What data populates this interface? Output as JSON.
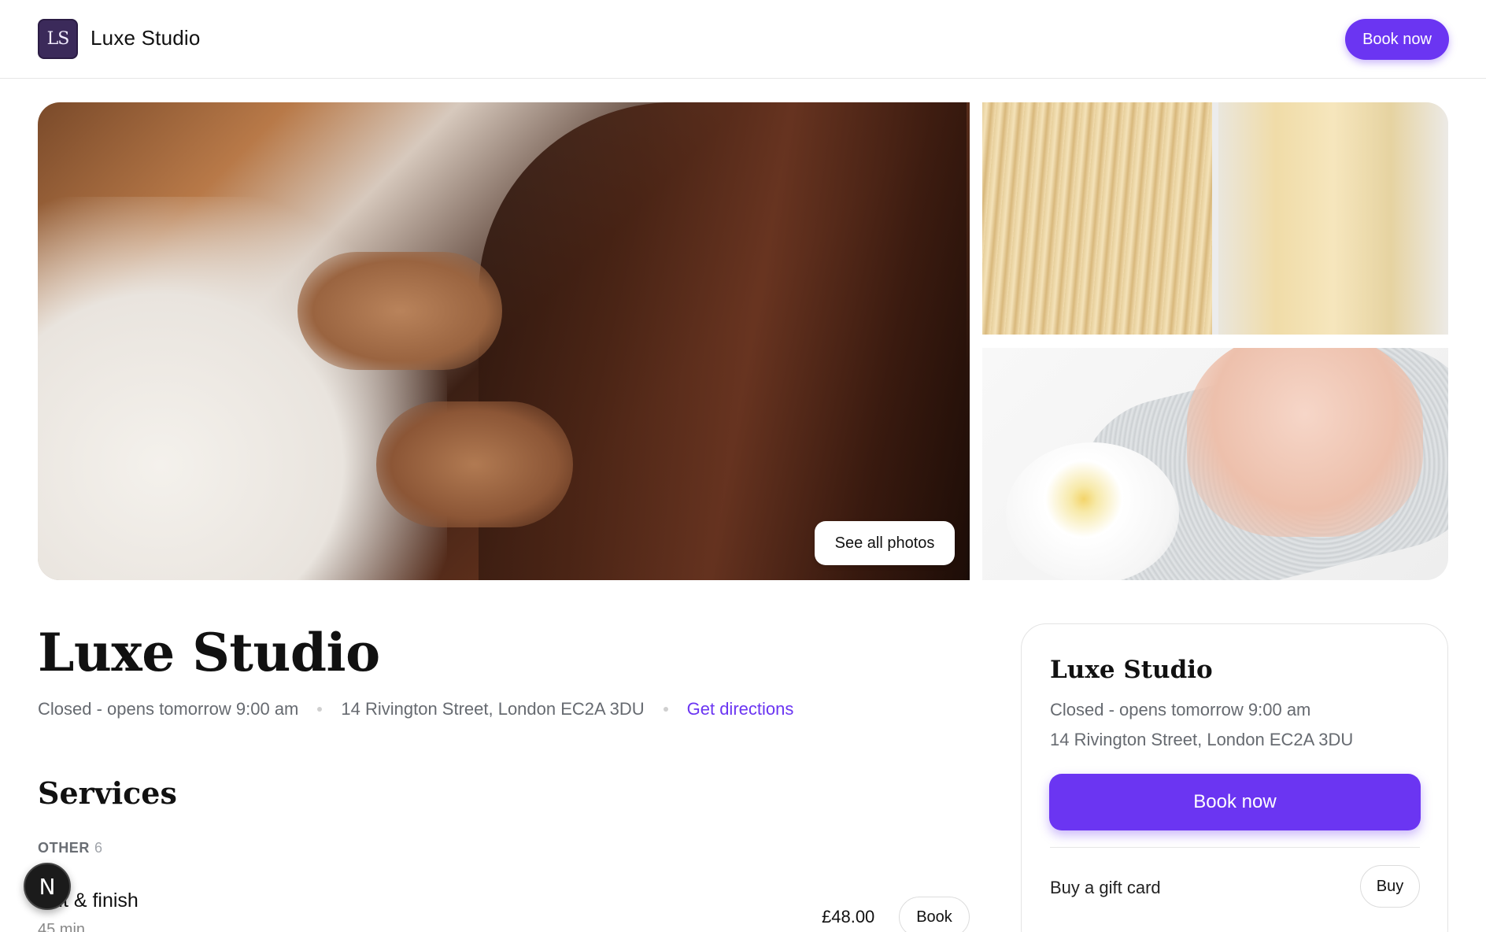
{
  "header": {
    "logo_text": "LS",
    "brand": "Luxe Studio",
    "book_label": "Book now"
  },
  "gallery": {
    "see_all_label": "See all photos",
    "images": [
      "hair-cutting-photo",
      "blonde-hair-before-after-photo",
      "manicure-nails-photo"
    ]
  },
  "business": {
    "name": "Luxe Studio",
    "status": "Closed - opens tomorrow 9:00 am",
    "address": "14 Rivington Street, London EC2A 3DU",
    "directions_label": "Get directions"
  },
  "services": {
    "heading": "Services",
    "category": {
      "name": "OTHER",
      "count": "6"
    },
    "items": [
      {
        "name": "Cut & finish",
        "duration": "45 min",
        "price": "£48.00",
        "book_label": "Book"
      }
    ]
  },
  "card": {
    "title": "Luxe Studio",
    "status": "Closed - opens tomorrow 9:00 am",
    "address": "14 Rivington Street, London EC2A 3DU",
    "book_label": "Book now",
    "gift_label": "Buy a gift card",
    "gift_button": "Buy"
  },
  "badge": {
    "letter": "N"
  },
  "colors": {
    "accent": "#6b35f2",
    "muted_text": "#666a70"
  }
}
